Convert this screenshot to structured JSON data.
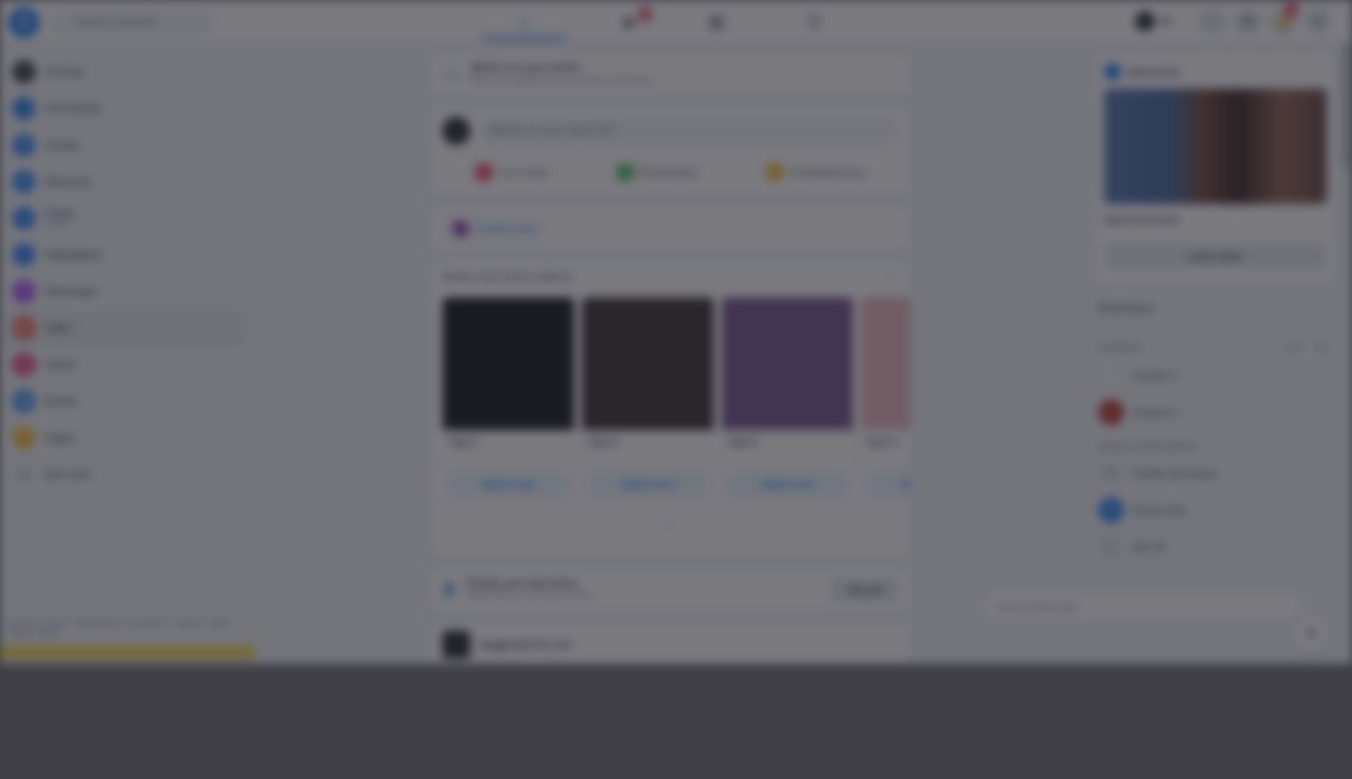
{
  "topbar": {
    "logo": "f",
    "search_placeholder": "Search Facebook",
    "search_icon": "⌕",
    "nav": [
      {
        "name": "home",
        "icon": "⌂",
        "badge": ""
      },
      {
        "name": "watch",
        "icon": "▶",
        "badge": "9+"
      },
      {
        "name": "marketplace",
        "icon": "▦",
        "badge": ""
      },
      {
        "name": "groups",
        "icon": "☰",
        "badge": ""
      }
    ],
    "profile_name": "Ali",
    "buttons": [
      {
        "name": "menu",
        "icon": "⋮⋮",
        "badge": ""
      },
      {
        "name": "messenger",
        "icon": "✉",
        "badge": ""
      },
      {
        "name": "notifications",
        "icon": "🔔",
        "badge": "8"
      },
      {
        "name": "account",
        "icon": "▾",
        "badge": ""
      }
    ]
  },
  "sidebar": {
    "items": [
      {
        "label": "Ali Khan",
        "sub": "",
        "color": "#1c1e21",
        "icon": "●"
      },
      {
        "label": "Find friends",
        "sub": "",
        "color": "#1877f2",
        "icon": "👥"
      },
      {
        "label": "Groups",
        "sub": "",
        "color": "#1877f2",
        "icon": "⚑"
      },
      {
        "label": "Memories",
        "sub": "",
        "color": "#1877f2",
        "icon": "⟲"
      },
      {
        "label": "Feeds",
        "sub": "2 new",
        "color": "#1877f2",
        "icon": "≡"
      },
      {
        "label": "Marketplace",
        "sub": "",
        "color": "#1877f2",
        "icon": "⌂"
      },
      {
        "label": "Messenger",
        "sub": "",
        "color": "#a033ff",
        "icon": "✉"
      },
      {
        "label": "Video",
        "sub": "",
        "color": "#f5533d",
        "icon": "▶"
      },
      {
        "label": "Saved",
        "sub": "",
        "color": "#e91e63",
        "icon": "❚"
      },
      {
        "label": "Events",
        "sub": "",
        "color": "#1877f2",
        "icon": "▣"
      },
      {
        "label": "Pages",
        "sub": "",
        "color": "#f7b928",
        "icon": "⚐"
      },
      {
        "label": "See more",
        "sub": "",
        "color": "#e4e6eb",
        "icon": "⌄"
      }
    ],
    "footer": "Privacy · Terms · Advertising · Ad choices · Cookies · More · Meta © 2024"
  },
  "feed": {
    "notice": {
      "title": "What's on your mind?",
      "subtitle": "Share an update with your friends and family",
      "icon": "i"
    },
    "composer": {
      "placeholder": "What's on your mind, Ali?",
      "actions": [
        {
          "label": "Live video",
          "color": "#f3425f"
        },
        {
          "label": "Photo/video",
          "color": "#45bd62"
        },
        {
          "label": "Feeling/activity",
          "color": "#f7b928"
        }
      ]
    },
    "room_label": "Create room",
    "reels": {
      "title": "Reels and short videos",
      "more_icon": "⋯",
      "items": [
        {
          "name": "Reel 1",
          "button": "Watch now",
          "shade": "#05050e"
        },
        {
          "name": "Reel 2",
          "button": "Watch now",
          "shade": "#2a2020"
        },
        {
          "name": "Reel 3",
          "button": "Watch now",
          "shade": "#6a4c8a"
        },
        {
          "name": "Reel 4",
          "button": "Watch now",
          "shade": "#e8b0b8"
        }
      ],
      "see_more": "⌄"
    },
    "suggest": {
      "title": "People you may know",
      "subtitle": "Add friends to see more stories",
      "button": "See all",
      "icon": "👤"
    },
    "post": {
      "title": "Suggested for you"
    }
  },
  "rightcol": {
    "sponsored": {
      "label": "Sponsored",
      "caption": "Sponsored post",
      "button": "Learn more"
    },
    "birthdays_heading": "Birthdays",
    "contacts_heading": "Contacts",
    "contacts_tools": [
      "⌕",
      "⋯"
    ],
    "contacts": [
      {
        "name": "Contact 1",
        "color": "#f0f2f5",
        "icon": "☺"
      },
      {
        "name": "Contact 2",
        "color": "#b3261e",
        "icon": "☺"
      }
    ],
    "group_label": "Group conversations",
    "groups": [
      {
        "name": "Create new group",
        "color": "#e4e6eb",
        "icon": "+"
      },
      {
        "name": "Group chat",
        "color": "#1877f2",
        "icon": "✉"
      },
      {
        "name": "See all",
        "color": "#e4e6eb",
        "icon": "⌄"
      }
    ]
  },
  "chat": {
    "placeholder": "Search Messenger",
    "compose_icon": "✎"
  }
}
